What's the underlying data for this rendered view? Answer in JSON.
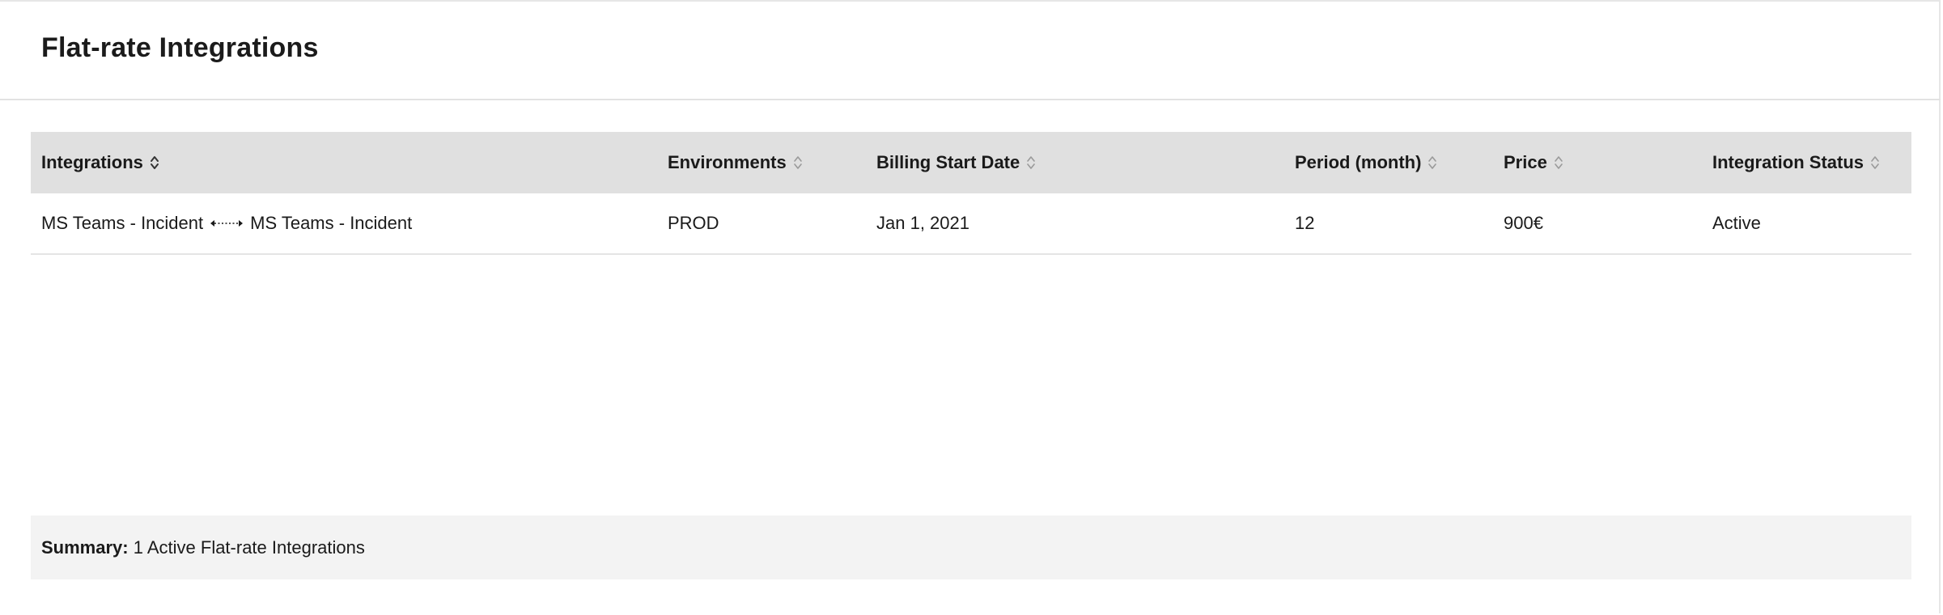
{
  "page": {
    "title": "Flat-rate Integrations"
  },
  "table": {
    "columns": [
      {
        "label": "Integrations",
        "sort": "active"
      },
      {
        "label": "Environments",
        "sort": "inactive"
      },
      {
        "label": "Billing Start Date",
        "sort": "inactive"
      },
      {
        "label": "Period (month)",
        "sort": "inactive"
      },
      {
        "label": "Price",
        "sort": "inactive"
      },
      {
        "label": "Integration Status",
        "sort": "inactive"
      }
    ],
    "rows": [
      {
        "integration_left": "MS Teams - Incident",
        "integration_right": "MS Teams - Incident",
        "link_icon": "bidirectional-arrow-icon",
        "environment": "PROD",
        "billing_start_date": "Jan 1, 2021",
        "period": "12",
        "price": "900€",
        "status": "Active"
      }
    ]
  },
  "summary": {
    "label": "Summary:",
    "text": "1 Active Flat-rate Integrations"
  },
  "colors": {
    "header_bg": "#e0e0e0",
    "summary_bg": "#f3f3f3",
    "sort_active": "#333333",
    "sort_inactive": "#9a9a9a"
  }
}
